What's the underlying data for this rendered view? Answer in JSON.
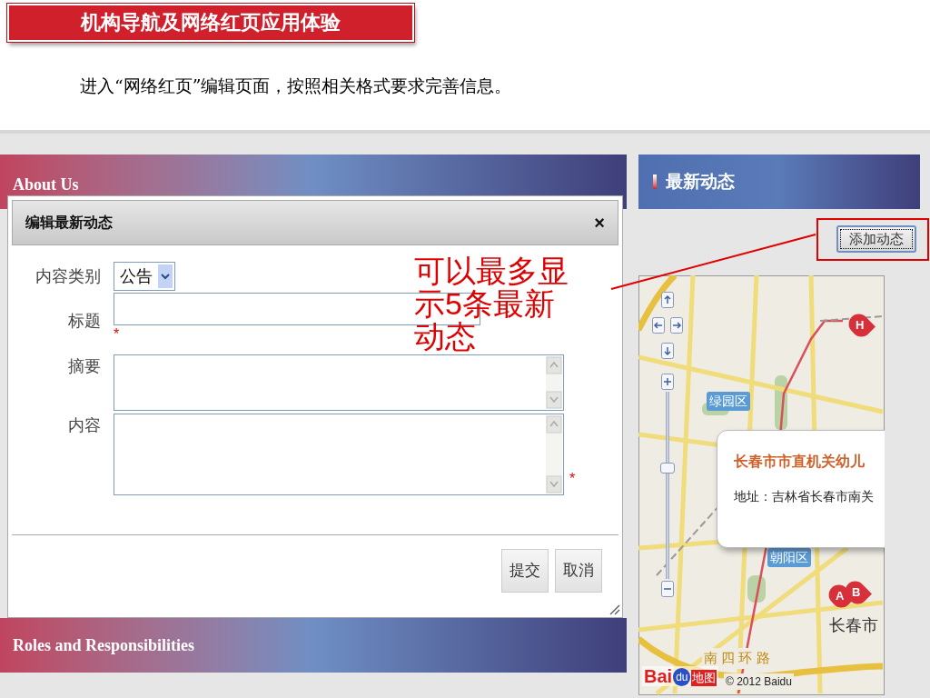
{
  "slide": {
    "title": "机构导航及网络红页应用体验",
    "instruction": "进入“网络红页”编辑页面，按照相关格式要求完善信息。"
  },
  "page": {
    "left_sections": [
      {
        "title": "About Us"
      },
      {
        "title": "Roles and Responsibilities"
      }
    ],
    "right_panel": {
      "title": "最新动态",
      "add_button": "添加动态",
      "map": {
        "zoom_slider": {
          "level": 0.6
        },
        "labels": [
          {
            "kind": "district",
            "text": "绿园区"
          },
          {
            "kind": "district",
            "text": "朝阳区"
          },
          {
            "kind": "city",
            "text": "长春市"
          },
          {
            "kind": "road",
            "text": "南 四 环 路"
          }
        ],
        "markers": [
          "H",
          "A",
          "B"
        ],
        "popup": {
          "title": "长春市市直机关幼儿",
          "address": "地址：吉林省长春市南关"
        },
        "logo": {
          "part_1": "Bai",
          "part_2": "du",
          "part_3": "地图"
        },
        "copyright": "© 2012 Baidu"
      }
    }
  },
  "dialog": {
    "title": "编辑最新动态",
    "close": "×",
    "required_mark": "*",
    "fields": [
      {
        "kind": "select",
        "label": "内容类别",
        "value": "公告",
        "required": false
      },
      {
        "kind": "text",
        "label": "标题",
        "required": true
      },
      {
        "kind": "textarea",
        "label": "摘要",
        "required": false
      },
      {
        "kind": "textarea",
        "label": "内容",
        "required": true
      }
    ],
    "buttons": [
      "提交",
      "取消"
    ]
  },
  "annotation": {
    "text": "可以最多显示5条最新动态"
  }
}
